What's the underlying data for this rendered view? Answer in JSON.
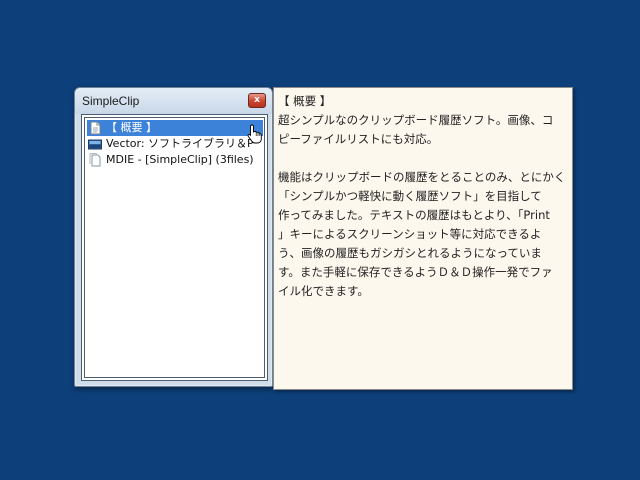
{
  "window": {
    "title": "SimpleClip",
    "close_glyph": "x",
    "items": [
      {
        "label": "【 概要 】",
        "icon": "document-icon",
        "selected": true
      },
      {
        "label": "Vector: ソフトライブラリ＆P",
        "icon": "image-icon",
        "selected": false
      },
      {
        "label": "MDIE - [SimpleClip] (3files)",
        "icon": "file-list-icon",
        "selected": false
      }
    ]
  },
  "preview": {
    "heading": "【 概要 】",
    "lines_1": [
      "超シンプルなのクリップボード履歴ソフト。画像、コ",
      "ピーファイルリストにも対応。"
    ],
    "lines_2": [
      "機能はクリップボードの履歴をとることのみ、とにかく",
      "「シンプルかつ軽快に動く履歴ソフト」を目指して",
      "作ってみました。テキストの履歴はもとより、「Print",
      "」キーによるスクリーンショット等に対応できるよ",
      "う、画像の履歴もガシガシとれるようになっていま",
      "す。また手軽に保存できるようＤ＆Ｄ操作一発でファ",
      "イル化できます。"
    ]
  },
  "colors": {
    "desktop": "#0d3f7a",
    "selection": "#3b82d8",
    "tooltip_bg": "#fdf8ee"
  }
}
